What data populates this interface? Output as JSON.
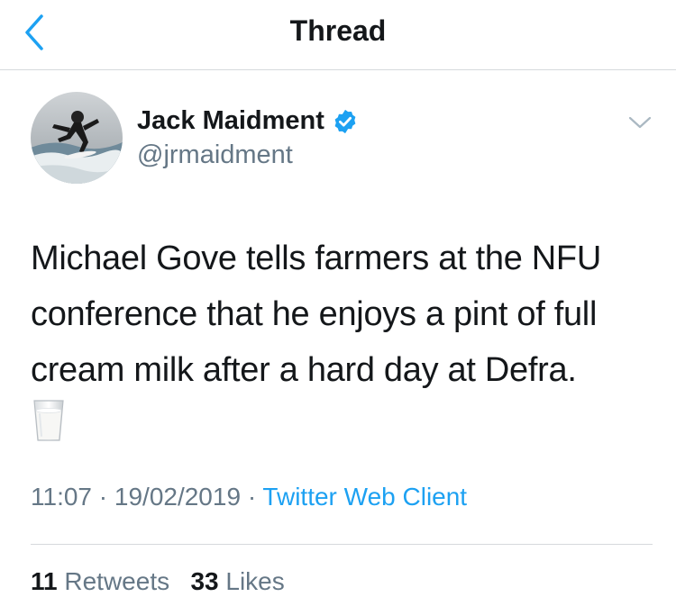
{
  "nav": {
    "title": "Thread",
    "back_icon": "chevron-left-icon"
  },
  "tweet": {
    "author": {
      "display_name": "Jack Maidment",
      "handle": "@jrmaidment",
      "verified": true
    },
    "text": "Michael Gove tells farmers at the NFU conference that he enjoys a pint of full cream milk after a hard day at Defra.",
    "emoji": "milk-glass-icon",
    "time": "11:07",
    "date": "19/02/2019",
    "separator": "·",
    "source": "Twitter Web Client",
    "stats": {
      "retweets_count": "11",
      "retweets_label": "Retweets",
      "likes_count": "33",
      "likes_label": "Likes"
    }
  },
  "colors": {
    "accent": "#1da1f2",
    "secondary_text": "#657786",
    "primary_text": "#14171a",
    "divider": "#d6d9dc"
  }
}
